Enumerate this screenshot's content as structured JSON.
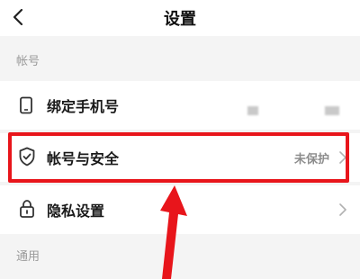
{
  "header": {
    "title": "设置"
  },
  "sections": {
    "account_label": "帐号",
    "general_label": "通用"
  },
  "rows": {
    "bind_phone": {
      "label": "绑定手机号"
    },
    "account_security": {
      "label": "帐号与安全",
      "value": "未保护"
    },
    "privacy": {
      "label": "隐私设置"
    }
  },
  "colors": {
    "highlight": "#e8151b",
    "arrow": "#e8151b",
    "background": "#f4f4f4"
  },
  "icons": {
    "back": "chevron-left-icon",
    "phone": "phone-icon",
    "shield": "shield-check-icon",
    "lock": "lock-icon",
    "chevron": "chevron-right-icon"
  }
}
